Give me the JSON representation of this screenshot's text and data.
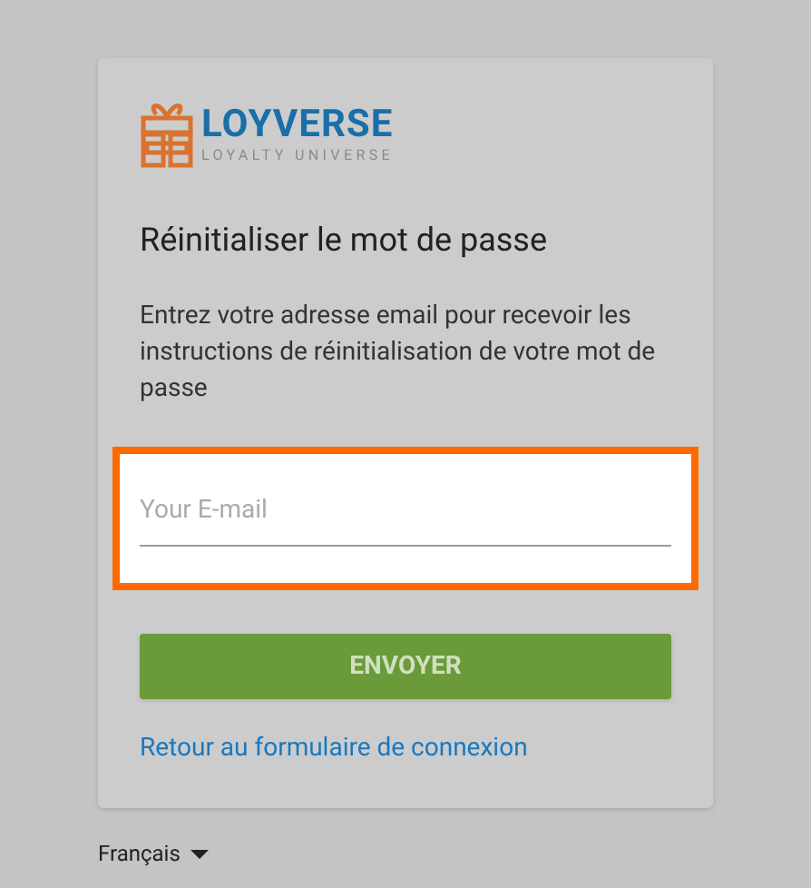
{
  "logo": {
    "name": "LOYVERSE",
    "tagline": "LOYALTY UNIVERSE"
  },
  "title": "Réinitialiser le mot de passe",
  "description": "Entrez votre adresse email pour recevoir les instructions de réinitialisation de votre mot de passe",
  "email_field": {
    "placeholder": "Your E-mail",
    "highlighted": true
  },
  "submit_button": "ENVOYER",
  "back_link": "Retour au formulaire de connexion",
  "language": "Français"
}
